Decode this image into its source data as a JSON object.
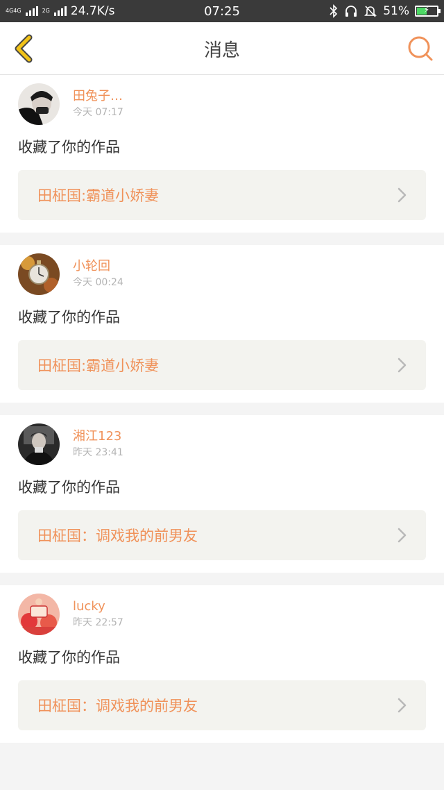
{
  "status_bar": {
    "network_left": "4G4G",
    "network_mid": "2G",
    "speed": "24.7K/s",
    "time": "07:25",
    "battery_percent": "51%",
    "battery_level": 0.51
  },
  "nav": {
    "title": "消息",
    "back_icon": "back-chevron-icon",
    "search_icon": "search-icon"
  },
  "messages": [
    {
      "user_name": "田兔子…",
      "time": "今天 07:17",
      "action": "收藏了你的作品",
      "work_title": "田柾国:霸道小娇妻",
      "avatar_icon": "avatar-1"
    },
    {
      "user_name": "小轮回",
      "time": "今天 00:24",
      "action": "收藏了你的作品",
      "work_title": "田柾国:霸道小娇妻",
      "avatar_icon": "avatar-2"
    },
    {
      "user_name": "湘江123",
      "time": "昨天 23:41",
      "action": "收藏了你的作品",
      "work_title": "田柾国：调戏我的前男友",
      "avatar_icon": "avatar-3"
    },
    {
      "user_name": "lucky",
      "time": "昨天 22:57",
      "action": "收藏了你的作品",
      "work_title": "田柾国：调戏我的前男友",
      "avatar_icon": "avatar-4"
    }
  ],
  "colors": {
    "accent": "#f0925a",
    "back_icon": "#f2c318",
    "status_bar_bg": "#3a3a3a"
  }
}
